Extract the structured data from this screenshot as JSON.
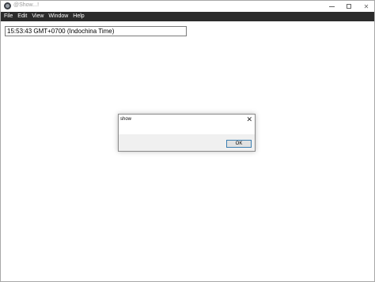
{
  "window": {
    "title": "@Show...!",
    "minimize_icon": "minimize-icon",
    "maximize_icon": "maximize-icon",
    "close_glyph": "✕"
  },
  "menubar": {
    "items": [
      "File",
      "Edit",
      "View",
      "Window",
      "Help"
    ]
  },
  "main": {
    "time_value": "15:53:43 GMT+0700 (Indochina Time)"
  },
  "dialog": {
    "title": "show",
    "close_glyph": "✕",
    "ok_label": "OK"
  },
  "colors": {
    "menubar_bg": "#2b2b2b",
    "dialog_footer_bg": "#f0f0f0",
    "ok_border": "#3c7fb1"
  }
}
